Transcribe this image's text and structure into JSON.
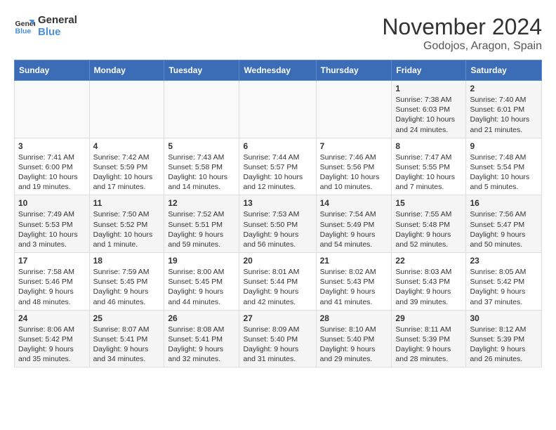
{
  "logo": {
    "line1": "General",
    "line2": "Blue"
  },
  "title": "November 2024",
  "subtitle": "Godojos, Aragon, Spain",
  "headers": [
    "Sunday",
    "Monday",
    "Tuesday",
    "Wednesday",
    "Thursday",
    "Friday",
    "Saturday"
  ],
  "weeks": [
    [
      {
        "day": "",
        "info": ""
      },
      {
        "day": "",
        "info": ""
      },
      {
        "day": "",
        "info": ""
      },
      {
        "day": "",
        "info": ""
      },
      {
        "day": "",
        "info": ""
      },
      {
        "day": "1",
        "info": "Sunrise: 7:38 AM\nSunset: 6:03 PM\nDaylight: 10 hours and 24 minutes."
      },
      {
        "day": "2",
        "info": "Sunrise: 7:40 AM\nSunset: 6:01 PM\nDaylight: 10 hours and 21 minutes."
      }
    ],
    [
      {
        "day": "3",
        "info": "Sunrise: 7:41 AM\nSunset: 6:00 PM\nDaylight: 10 hours and 19 minutes."
      },
      {
        "day": "4",
        "info": "Sunrise: 7:42 AM\nSunset: 5:59 PM\nDaylight: 10 hours and 17 minutes."
      },
      {
        "day": "5",
        "info": "Sunrise: 7:43 AM\nSunset: 5:58 PM\nDaylight: 10 hours and 14 minutes."
      },
      {
        "day": "6",
        "info": "Sunrise: 7:44 AM\nSunset: 5:57 PM\nDaylight: 10 hours and 12 minutes."
      },
      {
        "day": "7",
        "info": "Sunrise: 7:46 AM\nSunset: 5:56 PM\nDaylight: 10 hours and 10 minutes."
      },
      {
        "day": "8",
        "info": "Sunrise: 7:47 AM\nSunset: 5:55 PM\nDaylight: 10 hours and 7 minutes."
      },
      {
        "day": "9",
        "info": "Sunrise: 7:48 AM\nSunset: 5:54 PM\nDaylight: 10 hours and 5 minutes."
      }
    ],
    [
      {
        "day": "10",
        "info": "Sunrise: 7:49 AM\nSunset: 5:53 PM\nDaylight: 10 hours and 3 minutes."
      },
      {
        "day": "11",
        "info": "Sunrise: 7:50 AM\nSunset: 5:52 PM\nDaylight: 10 hours and 1 minute."
      },
      {
        "day": "12",
        "info": "Sunrise: 7:52 AM\nSunset: 5:51 PM\nDaylight: 9 hours and 59 minutes."
      },
      {
        "day": "13",
        "info": "Sunrise: 7:53 AM\nSunset: 5:50 PM\nDaylight: 9 hours and 56 minutes."
      },
      {
        "day": "14",
        "info": "Sunrise: 7:54 AM\nSunset: 5:49 PM\nDaylight: 9 hours and 54 minutes."
      },
      {
        "day": "15",
        "info": "Sunrise: 7:55 AM\nSunset: 5:48 PM\nDaylight: 9 hours and 52 minutes."
      },
      {
        "day": "16",
        "info": "Sunrise: 7:56 AM\nSunset: 5:47 PM\nDaylight: 9 hours and 50 minutes."
      }
    ],
    [
      {
        "day": "17",
        "info": "Sunrise: 7:58 AM\nSunset: 5:46 PM\nDaylight: 9 hours and 48 minutes."
      },
      {
        "day": "18",
        "info": "Sunrise: 7:59 AM\nSunset: 5:45 PM\nDaylight: 9 hours and 46 minutes."
      },
      {
        "day": "19",
        "info": "Sunrise: 8:00 AM\nSunset: 5:45 PM\nDaylight: 9 hours and 44 minutes."
      },
      {
        "day": "20",
        "info": "Sunrise: 8:01 AM\nSunset: 5:44 PM\nDaylight: 9 hours and 42 minutes."
      },
      {
        "day": "21",
        "info": "Sunrise: 8:02 AM\nSunset: 5:43 PM\nDaylight: 9 hours and 41 minutes."
      },
      {
        "day": "22",
        "info": "Sunrise: 8:03 AM\nSunset: 5:43 PM\nDaylight: 9 hours and 39 minutes."
      },
      {
        "day": "23",
        "info": "Sunrise: 8:05 AM\nSunset: 5:42 PM\nDaylight: 9 hours and 37 minutes."
      }
    ],
    [
      {
        "day": "24",
        "info": "Sunrise: 8:06 AM\nSunset: 5:42 PM\nDaylight: 9 hours and 35 minutes."
      },
      {
        "day": "25",
        "info": "Sunrise: 8:07 AM\nSunset: 5:41 PM\nDaylight: 9 hours and 34 minutes."
      },
      {
        "day": "26",
        "info": "Sunrise: 8:08 AM\nSunset: 5:41 PM\nDaylight: 9 hours and 32 minutes."
      },
      {
        "day": "27",
        "info": "Sunrise: 8:09 AM\nSunset: 5:40 PM\nDaylight: 9 hours and 31 minutes."
      },
      {
        "day": "28",
        "info": "Sunrise: 8:10 AM\nSunset: 5:40 PM\nDaylight: 9 hours and 29 minutes."
      },
      {
        "day": "29",
        "info": "Sunrise: 8:11 AM\nSunset: 5:39 PM\nDaylight: 9 hours and 28 minutes."
      },
      {
        "day": "30",
        "info": "Sunrise: 8:12 AM\nSunset: 5:39 PM\nDaylight: 9 hours and 26 minutes."
      }
    ]
  ]
}
